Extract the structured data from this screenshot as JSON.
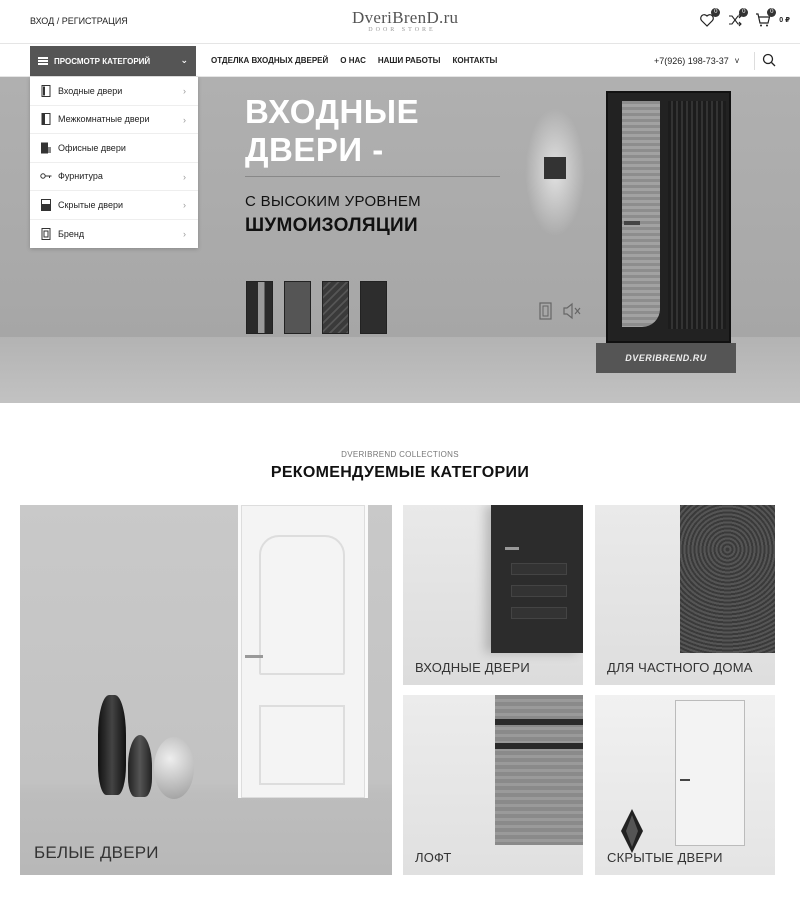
{
  "header": {
    "login_label": "ВХОД / РЕГИСТРАЦИЯ",
    "logo_main": "DveriBrenD.ru",
    "logo_sub": "DOOR STORE",
    "wishlist_count": "0",
    "compare_count": "0",
    "cart_count": "0",
    "cart_total": "0 ₽"
  },
  "nav": {
    "categories_button": "ПРОСМОТР КАТЕГОРИЙ",
    "links": [
      "ОТДЕЛКА ВХОДНЫХ ДВЕРЕЙ",
      "О НАС",
      "НАШИ РАБОТЫ",
      "КОНТАКТЫ"
    ],
    "phone": "+7(926) 198-73-37",
    "phone_toggle": "v"
  },
  "categories_menu": [
    {
      "label": "Входные двери",
      "icon": "door-icon",
      "has_children": true
    },
    {
      "label": "Межкомнатные двери",
      "icon": "interior-door-icon",
      "has_children": true
    },
    {
      "label": "Офисные двери",
      "icon": "office-door-icon",
      "has_children": false
    },
    {
      "label": "Фурнитура",
      "icon": "key-icon",
      "has_children": true
    },
    {
      "label": "Скрытые двери",
      "icon": "hidden-door-icon",
      "has_children": true
    },
    {
      "label": "Бренд",
      "icon": "brand-icon",
      "has_children": true
    }
  ],
  "hero": {
    "title_line1": "ВХОДНЫЕ",
    "title_line2": "ДВЕРИ -",
    "subtitle_line1": "С ВЫСОКИМ УРОВНЕМ",
    "subtitle_line2": "ШУМОИЗОЛЯЦИИ",
    "mat_text": "DVERIBREND.RU",
    "thumbnails": [
      "door-variant-1",
      "door-variant-2",
      "door-variant-3",
      "door-variant-4"
    ]
  },
  "collections": {
    "overline": "DVERIBREND COLLECTIONS",
    "title": "РЕКОМЕНДУЕМЫЕ КАТЕГОРИИ",
    "cards": [
      {
        "label": "БЕЛЫЕ ДВЕРИ"
      },
      {
        "label": "ВХОДНЫЕ ДВЕРИ"
      },
      {
        "label": "ДЛЯ ЧАСТНОГО ДОМА"
      },
      {
        "label": "ЛОФТ"
      },
      {
        "label": "СКРЫТЫЕ ДВЕРИ"
      }
    ]
  }
}
